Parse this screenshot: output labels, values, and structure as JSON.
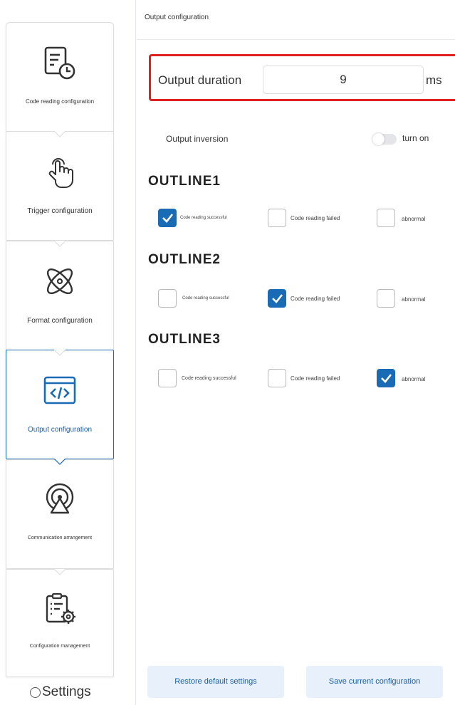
{
  "sidebar": {
    "items": [
      {
        "label": "Code reading configuration",
        "icon": "document-clock-icon",
        "active": false
      },
      {
        "label": "Trigger configuration",
        "icon": "hand-pointer-icon",
        "active": false
      },
      {
        "label": "Format configuration",
        "icon": "atom-icon",
        "active": false
      },
      {
        "label": "Output configuration",
        "icon": "code-window-icon",
        "active": true
      },
      {
        "label": "Communication arrangement",
        "icon": "signal-tower-icon",
        "active": false
      },
      {
        "label": "Configuration management",
        "icon": "clipboard-gear-icon",
        "active": false
      }
    ],
    "footer_label": "Settings"
  },
  "main": {
    "breadcrumb": "Output configuration",
    "output_duration": {
      "label": "Output duration",
      "value": "9",
      "unit": "ms"
    },
    "output_inversion": {
      "label": "Output inversion",
      "toggle_text": "turn on",
      "on": false
    },
    "outlines": [
      {
        "title": "OUTLINE1",
        "options": [
          {
            "label": "Code reading successful",
            "checked": true
          },
          {
            "label": "Code reading failed",
            "checked": false
          },
          {
            "label": "abnormal",
            "checked": false
          }
        ]
      },
      {
        "title": "OUTLINE2",
        "options": [
          {
            "label": "Code reading successful",
            "checked": false
          },
          {
            "label": "Code reading failed",
            "checked": true
          },
          {
            "label": "abnormal",
            "checked": false
          }
        ]
      },
      {
        "title": "OUTLINE3",
        "options": [
          {
            "label": "Code reading successful",
            "checked": false
          },
          {
            "label": "Code reading failed",
            "checked": false
          },
          {
            "label": "abnormal",
            "checked": true
          }
        ]
      }
    ],
    "buttons": {
      "restore": "Restore default settings",
      "save": "Save current configuration"
    }
  },
  "colors": {
    "accent": "#1a6bb5",
    "highlight_border": "#e02020",
    "button_bg": "#e8f1fb"
  }
}
